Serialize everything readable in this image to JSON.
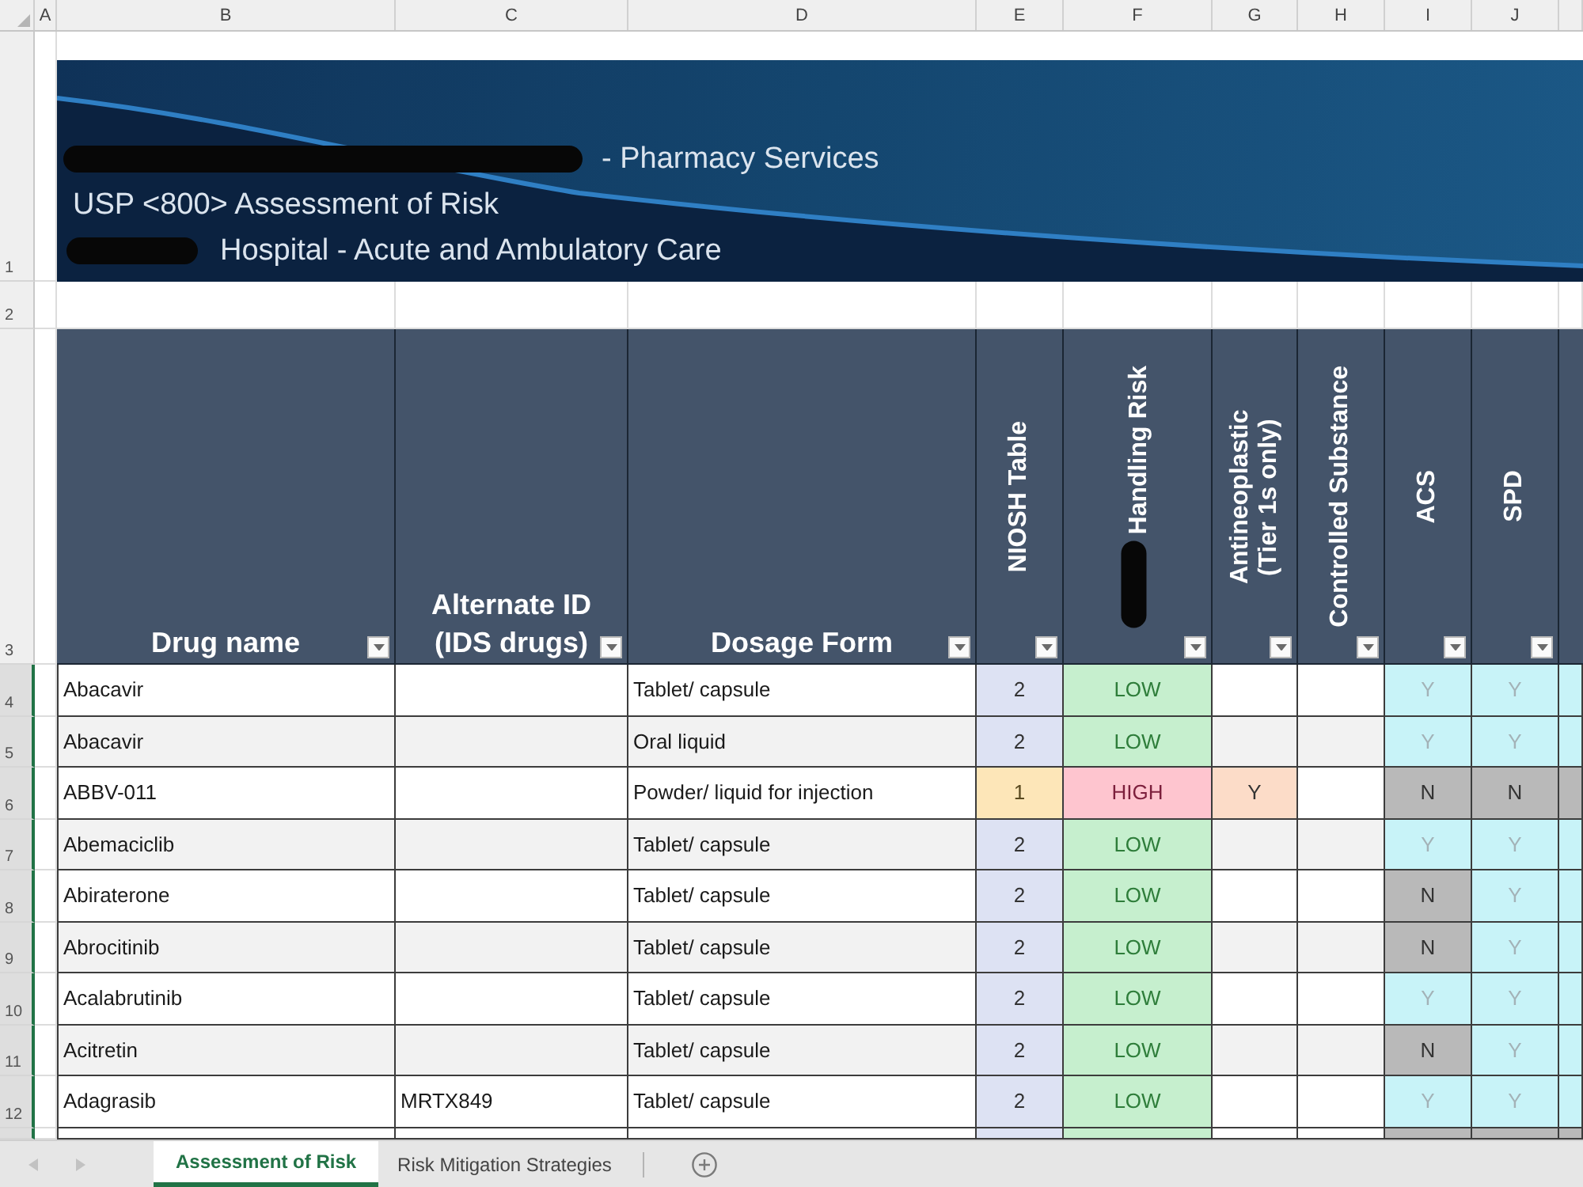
{
  "column_letters": [
    "A",
    "B",
    "C",
    "D",
    "E",
    "F",
    "G",
    "H",
    "I",
    "J"
  ],
  "banner": {
    "row_number": "1",
    "lines": [
      {
        "redacted": true,
        "text": "- Pharmacy Services"
      },
      {
        "text": "USP <800> Assessment of Risk"
      },
      {
        "redacted": true,
        "text": "Hospital - Acute and Ambulatory Care"
      }
    ]
  },
  "spacer_row": {
    "row_number": "2"
  },
  "table": {
    "header_row_number": "3",
    "columns": [
      {
        "label": "Drug name",
        "kind": "horizontal"
      },
      {
        "label": "Alternate ID (IDS drugs)",
        "kind": "horizontal"
      },
      {
        "label": "Dosage Form",
        "kind": "horizontal"
      },
      {
        "label": "NIOSH Table",
        "kind": "vertical"
      },
      {
        "label": "Handling Risk",
        "kind": "vertical",
        "redacted": true
      },
      {
        "label": "Antineoplastic (Tier 1s only)",
        "kind": "vertical"
      },
      {
        "label": "Controlled Substance",
        "kind": "vertical"
      },
      {
        "label": "ACS",
        "kind": "vertical"
      },
      {
        "label": "SPD",
        "kind": "vertical"
      }
    ],
    "rows": [
      {
        "row_number": "4",
        "selected": true,
        "drug_name": "Abacavir",
        "dosage_form": "Tablet/ capsule",
        "niosh_table": {
          "text": "2",
          "kind": "table2"
        },
        "handling_risk": {
          "text": "LOW",
          "kind": "low"
        },
        "acs": {
          "text": "Y",
          "kind": "yes"
        },
        "spd": {
          "text": "Y",
          "kind": "yes"
        },
        "column_11": {
          "kind": "yes"
        }
      },
      {
        "row_number": "5",
        "selected": true,
        "drug_name": "Abacavir",
        "dosage_form": "Oral liquid",
        "niosh_table": {
          "text": "2",
          "kind": "table2"
        },
        "handling_risk": {
          "text": "LOW",
          "kind": "low"
        },
        "acs": {
          "text": "Y",
          "kind": "yes"
        },
        "spd": {
          "text": "Y",
          "kind": "yes"
        },
        "column_11": {
          "kind": "yes"
        }
      },
      {
        "row_number": "6",
        "selected": true,
        "drug_name": "ABBV-011",
        "dosage_form": "Powder/ liquid for injection",
        "niosh_table": {
          "text": "1",
          "kind": "table1"
        },
        "handling_risk": {
          "text": "HIGH",
          "kind": "high"
        },
        "antineoplastic": {
          "text": "Y",
          "kind": "yes"
        },
        "acs": {
          "text": "N",
          "kind": "no"
        },
        "spd": {
          "text": "N",
          "kind": "no"
        },
        "column_11": {
          "kind": "no"
        }
      },
      {
        "row_number": "7",
        "selected": true,
        "drug_name": "Abemaciclib",
        "dosage_form": "Tablet/ capsule",
        "niosh_table": {
          "text": "2",
          "kind": "table2"
        },
        "handling_risk": {
          "text": "LOW",
          "kind": "low"
        },
        "acs": {
          "text": "Y",
          "kind": "yes"
        },
        "spd": {
          "text": "Y",
          "kind": "yes"
        },
        "column_11": {
          "kind": "yes"
        }
      },
      {
        "row_number": "8",
        "selected": true,
        "drug_name": "Abiraterone",
        "dosage_form": "Tablet/ capsule",
        "niosh_table": {
          "text": "2",
          "kind": "table2"
        },
        "handling_risk": {
          "text": "LOW",
          "kind": "low"
        },
        "acs": {
          "text": "N",
          "kind": "no"
        },
        "spd": {
          "text": "Y",
          "kind": "yes"
        },
        "column_11": {
          "kind": "yes"
        }
      },
      {
        "row_number": "9",
        "selected": true,
        "drug_name": "Abrocitinib",
        "dosage_form": "Tablet/ capsule",
        "niosh_table": {
          "text": "2",
          "kind": "table2"
        },
        "handling_risk": {
          "text": "LOW",
          "kind": "low"
        },
        "acs": {
          "text": "N",
          "kind": "no"
        },
        "spd": {
          "text": "Y",
          "kind": "yes"
        },
        "column_11": {
          "kind": "yes"
        }
      },
      {
        "row_number": "10",
        "selected": true,
        "drug_name": "Acalabrutinib",
        "dosage_form": "Tablet/ capsule",
        "niosh_table": {
          "text": "2",
          "kind": "table2"
        },
        "handling_risk": {
          "text": "LOW",
          "kind": "low"
        },
        "acs": {
          "text": "Y",
          "kind": "yes"
        },
        "spd": {
          "text": "Y",
          "kind": "yes"
        },
        "column_11": {
          "kind": "yes"
        }
      },
      {
        "row_number": "11",
        "selected": true,
        "drug_name": "Acitretin",
        "dosage_form": "Tablet/ capsule",
        "niosh_table": {
          "text": "2",
          "kind": "table2"
        },
        "handling_risk": {
          "text": "LOW",
          "kind": "low"
        },
        "acs": {
          "text": "N",
          "kind": "no"
        },
        "spd": {
          "text": "Y",
          "kind": "yes"
        },
        "column_11": {
          "kind": "yes"
        }
      },
      {
        "row_number": "12",
        "selected": true,
        "drug_name": "Adagrasib",
        "alternate_id": "MRTX849",
        "dosage_form": "Tablet/ capsule",
        "niosh_table": {
          "text": "2",
          "kind": "table2"
        },
        "handling_risk": {
          "text": "LOW",
          "kind": "low"
        },
        "acs": {
          "text": "Y",
          "kind": "yes"
        },
        "spd": {
          "text": "Y",
          "kind": "yes"
        },
        "column_11": {
          "kind": "yes"
        }
      }
    ],
    "cut_row": {
      "niosh_table": {
        "kind": "table2"
      },
      "handling_risk": {
        "kind": "low"
      },
      "acs": {
        "kind": "no"
      },
      "spd": {
        "kind": "no"
      },
      "column_11": {
        "kind": "no"
      }
    }
  },
  "sheet_tabs": [
    {
      "label": "Assessment of Risk",
      "selected": true
    },
    {
      "label": "Risk Mitigation Strategies",
      "selected": false
    }
  ]
}
